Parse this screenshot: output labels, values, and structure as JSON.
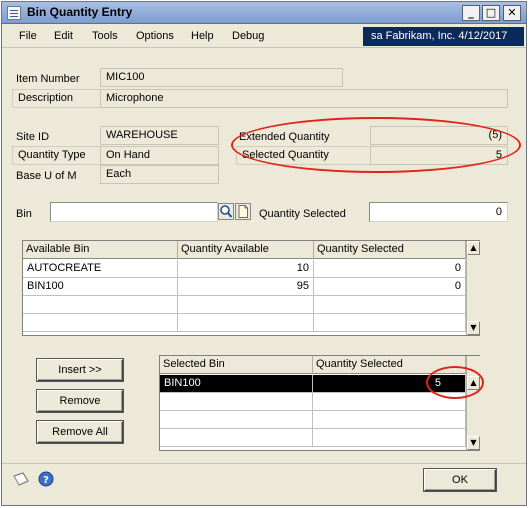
{
  "window": {
    "title": "Bin Quantity Entry",
    "buttons": {
      "minimize": "_",
      "maximize": "□",
      "close": "✕"
    }
  },
  "menu": {
    "items": [
      "File",
      "Edit",
      "Tools",
      "Options",
      "Help",
      "Debug"
    ],
    "company": "sa  Fabrikam, Inc.  4/12/2017"
  },
  "item": {
    "number_label": "Item Number",
    "number_value": "MIC100",
    "description_label": "Description",
    "description_value": "Microphone"
  },
  "details": {
    "site_label": "Site ID",
    "site_value": "WAREHOUSE",
    "qty_type_label": "Quantity Type",
    "qty_type_value": "On Hand",
    "base_uom_label": "Base U of M",
    "base_uom_value": "Each"
  },
  "quantities": {
    "extended_label": "Extended Quantity",
    "extended_value": "(5)",
    "selected_label": "Selected Quantity",
    "selected_value": "5"
  },
  "bin_entry": {
    "bin_label": "Bin",
    "bin_value": "",
    "qty_selected_label": "Quantity Selected",
    "qty_selected_value": "0"
  },
  "available_table": {
    "headers": [
      "Available Bin",
      "Quantity Available",
      "Quantity Selected"
    ],
    "rows": [
      [
        "AUTOCREATE",
        "10",
        "0"
      ],
      [
        "BIN100",
        "95",
        "0"
      ]
    ]
  },
  "selected_table": {
    "headers": [
      "Selected Bin",
      "Quantity Selected"
    ],
    "rows": [
      [
        "BIN100",
        "5"
      ]
    ]
  },
  "buttons": {
    "insert": "Insert >>",
    "remove": "Remove",
    "remove_all": "Remove All",
    "ok": "OK"
  },
  "colors": {
    "annotation": "#e0241b",
    "company_bar": "#0b2a5c",
    "selected_row": "#000000"
  }
}
